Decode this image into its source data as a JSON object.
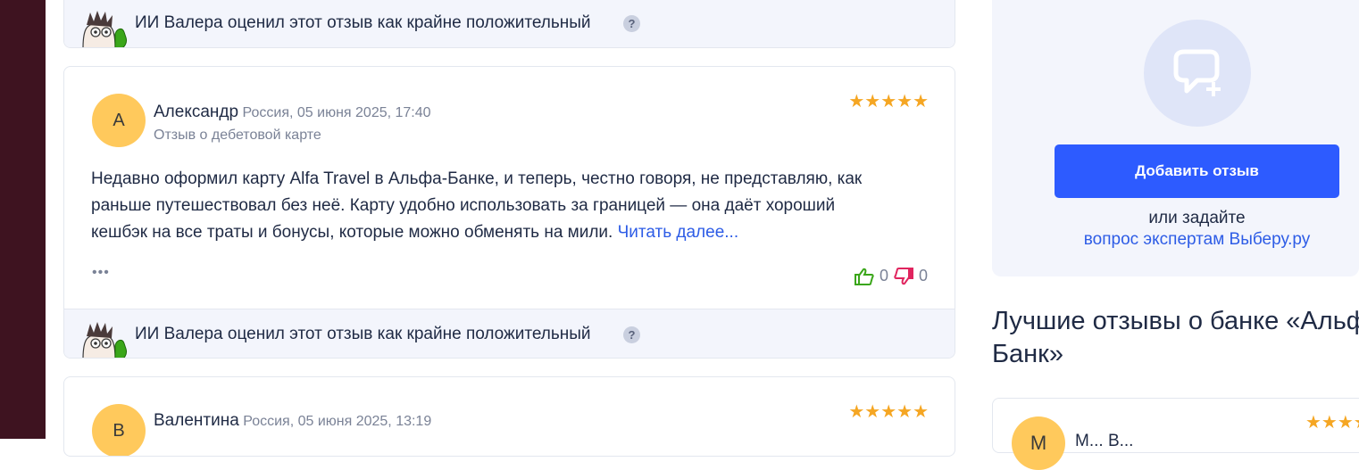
{
  "ai_note": {
    "text": "ИИ Валера оценил этот отзыв как крайне положительный",
    "help": "?"
  },
  "reviews": [
    {
      "initial": "А",
      "name": "Александр",
      "meta": "Россия, 05 июня 2025, 17:40",
      "type": "Отзыв о дебетовой карте",
      "stars": "★★★★★",
      "text": "Недавно оформил карту Alfa Travel в Альфа-Банке, и теперь, честно говоря, не представляю, как раньше путешествовал без неё. Карту удобно использовать за границей — она даёт хороший кешбэк на все траты и бонусы, которые можно обменять на мили.",
      "read_more": "Читать далее...",
      "more": "•••",
      "likes": "0",
      "dislikes": "0"
    },
    {
      "initial": "В",
      "name": "Валентина",
      "meta": "Россия, 05 июня 2025, 13:19",
      "stars": "★★★★★"
    }
  ],
  "sidebar": {
    "add_review": "Добавить отзыв",
    "or_ask": "или задайте",
    "experts_link": "вопрос экспертам Выберу.ру",
    "best_title_line1": "Лучшие отзывы о банке «Альфа-",
    "best_title_line2": "Банк»",
    "best_initial": "М",
    "best_name": "М... В...",
    "best_stars": "★★★★"
  },
  "colors": {
    "accent": "#2d5bff",
    "link": "#2d5ce6",
    "star": "#f5a623",
    "like": "#3aa619",
    "dislike": "#e0245e"
  }
}
